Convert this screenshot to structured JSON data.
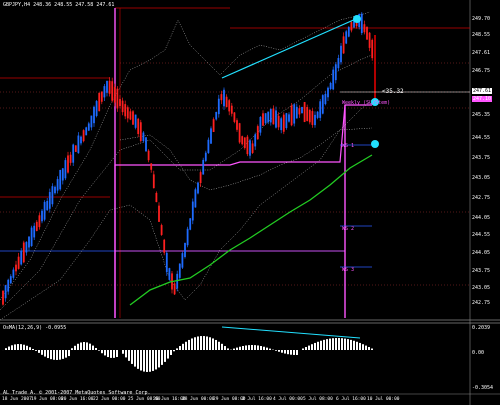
{
  "window": {
    "title": "GBPJPY,H4",
    "ohlc": "248.36 248.55 247.58 247.61"
  },
  "indicator": {
    "title": "OsMA(12,26,9) -0.0955",
    "scale": [
      "0.2039",
      "0.00",
      "-0.3054"
    ]
  },
  "copyright": "AL Trade A. © 2001-2007 MetaQuotes Software Corp.",
  "annotations": {
    "price_diff": "<35.32",
    "weekly_label": "Weekly (SL/Stem)",
    "ws1": "WS 1",
    "ws2": "WS 2",
    "ws3": "WS 3"
  },
  "price_axis": [
    "249.70",
    "248.55",
    "247.61",
    "246.75",
    "245.95",
    "245.35",
    "244.55",
    "243.75",
    "243.05",
    "242.75",
    "244.05"
  ],
  "price_badges": {
    "current": "247.61",
    "level": "247.10"
  },
  "date_axis": [
    "18 Jun 2007",
    "19 Jun 08:00",
    "20 Jun 16:00",
    "22 Jun 00:00",
    "25 Jun 08:00",
    "26 Jun 16:00",
    "28 Jun 00:00",
    "29 Jun 08:00",
    "2 Jul 16:00",
    "4 Jul 00:00",
    "5 Jul 08:00",
    "6 Jul 16:00",
    "10 Jul 00:00"
  ],
  "colors": {
    "up": "#1e6bff",
    "down": "#ff2020",
    "ma": "#22cc22",
    "pivot": "#ff55ff",
    "trend": "#22e0ff",
    "band": "#cfcfcf",
    "hline_red": "#cc0000",
    "hline_blue": "#2a5cff"
  }
}
